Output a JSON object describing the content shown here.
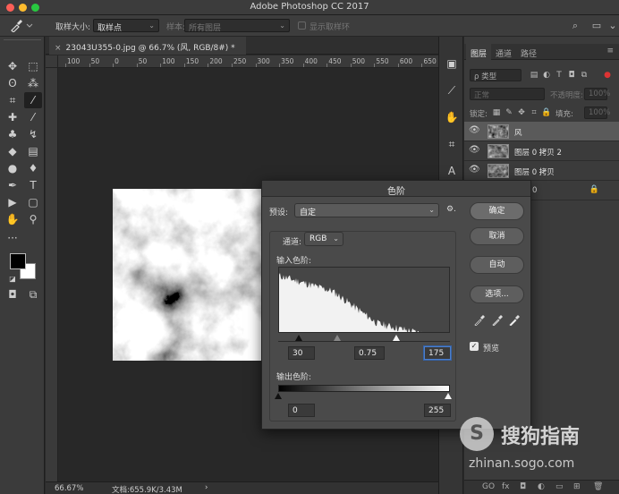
{
  "window": {
    "title": "Adobe Photoshop CC 2017"
  },
  "options_bar": {
    "tool_icon": "eyedropper-icon",
    "sample_size_label": "取样大小:",
    "sample_size_value": "取样点",
    "sample_label": "样本:",
    "sample_value": "所有图层",
    "show_ring_label": "显示取样环"
  },
  "document": {
    "tab_title": "23043U355-0.jpg @ 66.7% (风, RGB/8#) *",
    "close": "×",
    "ruler_labels": [
      "100",
      "50",
      "0",
      "50",
      "100",
      "150",
      "200",
      "250",
      "300",
      "350",
      "400",
      "450",
      "500",
      "550",
      "600",
      "650"
    ],
    "zoom": "66.67%",
    "doc_info": "文档:655.9K/3.43M",
    "status_arrow": "›"
  },
  "layers_panel": {
    "tabs": [
      "图层",
      "通道",
      "路径"
    ],
    "filter_placeholder": "ρ 类型",
    "blend_mode": "正常",
    "opacity_label": "不透明度:",
    "opacity_value": "100%",
    "lock_label": "锁定:",
    "fill_label": "填充:",
    "fill_value": "100%",
    "layers": [
      {
        "name": "风",
        "selected": true,
        "visible": true
      },
      {
        "name": "图层 0 拷贝 2",
        "selected": false,
        "visible": true
      },
      {
        "name": "图层 0 拷贝",
        "selected": false,
        "visible": true
      },
      {
        "name": "0",
        "selected": false,
        "visible": false,
        "locked": true
      }
    ],
    "bottom_icons": [
      "link-icon",
      "fx-icon",
      "mask-icon",
      "adjustment-icon",
      "group-icon",
      "new-layer-icon",
      "trash-icon"
    ],
    "bottom_labels": [
      "GO",
      "fx",
      "◘",
      "◐",
      "▭",
      "⊞",
      "🗑"
    ]
  },
  "levels_dialog": {
    "title": "色阶",
    "preset_label": "预设:",
    "preset_value": "自定",
    "channel_label": "通道:",
    "channel_value": "RGB",
    "input_label": "输入色阶:",
    "input_black": "30",
    "input_mid": "0.75",
    "input_white": "175",
    "input_black_level": 30,
    "input_mid_gamma": 0.75,
    "input_white_level": 175,
    "output_label": "输出色阶:",
    "output_black": "0",
    "output_white": "255",
    "buttons": {
      "ok": "确定",
      "cancel": "取消",
      "auto": "自动",
      "options": "选项..."
    },
    "preview_label": "预览",
    "preview_checked": true,
    "gear": "⚙."
  },
  "watermark": {
    "logo_letter": "S",
    "text": "搜狗指南",
    "url": "zhinan.sogo.com"
  },
  "colors": {
    "foreground": "#000000",
    "background": "#ffffff",
    "focus": "#4d7fcb"
  }
}
